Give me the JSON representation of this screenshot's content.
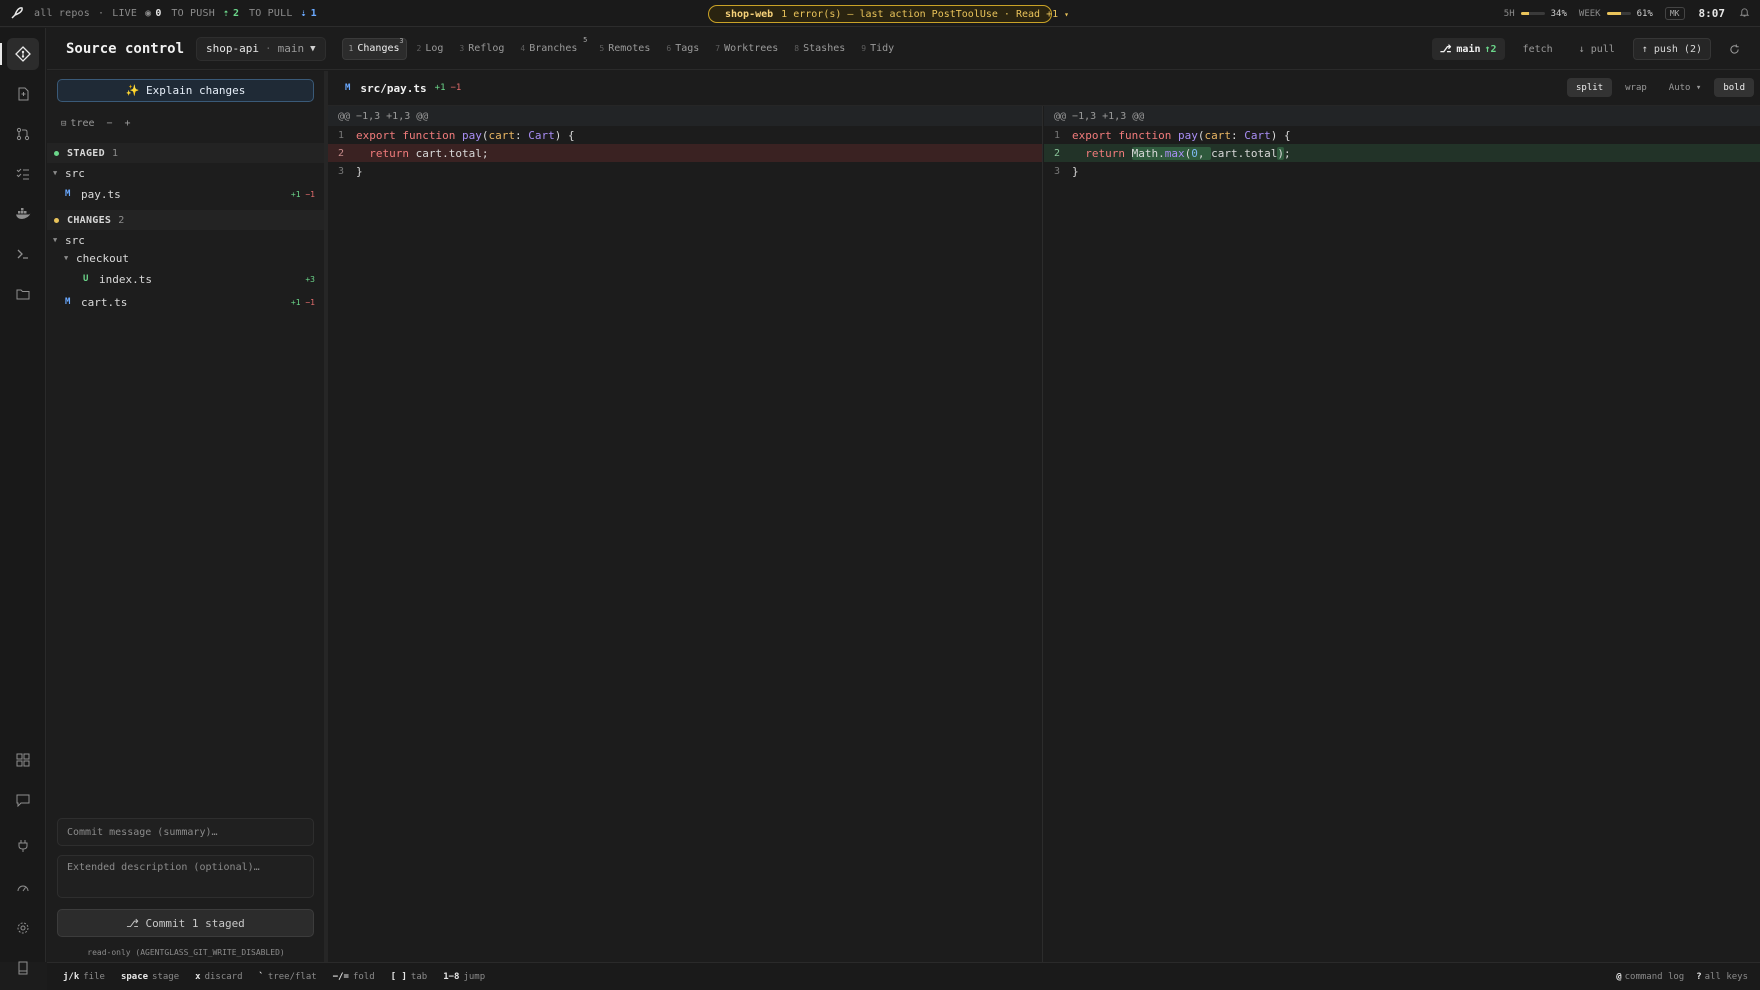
{
  "topbar": {
    "scope": "all repos",
    "live_label": "LIVE",
    "live_count": "0",
    "to_push_label": "TO PUSH",
    "to_push_count": "2",
    "to_pull_label": "TO PULL",
    "to_pull_count": "1",
    "alert": {
      "repo": "shop-web",
      "message": "1 error(s) — last action PostToolUse · Read +1",
      "caret": "▾"
    },
    "usage_5h_label": "5H",
    "usage_5h_pct": "34%",
    "usage_5h_fraction": 0.34,
    "usage_week_label": "WEEK",
    "usage_week_pct": "61%",
    "usage_week_fraction": 0.61,
    "user_initials": "MK",
    "clock": "8:07"
  },
  "header": {
    "title": "Source control",
    "repo": "shop-api",
    "branch": "main",
    "tabs": [
      {
        "num": "1",
        "label": "Changes",
        "badge": "3"
      },
      {
        "num": "2",
        "label": "Log",
        "badge": ""
      },
      {
        "num": "3",
        "label": "Reflog",
        "badge": ""
      },
      {
        "num": "4",
        "label": "Branches",
        "badge": "5"
      },
      {
        "num": "5",
        "label": "Remotes",
        "badge": ""
      },
      {
        "num": "6",
        "label": "Tags",
        "badge": ""
      },
      {
        "num": "7",
        "label": "Worktrees",
        "badge": ""
      },
      {
        "num": "8",
        "label": "Stashes",
        "badge": ""
      },
      {
        "num": "9",
        "label": "Tidy",
        "badge": ""
      }
    ],
    "branch_button": "main",
    "branch_ahead": "↑2",
    "fetch_label": "fetch",
    "pull_label": "↓ pull",
    "push_label": "↑ push (2)"
  },
  "panel": {
    "explain_label": "✨ Explain changes",
    "tree_label": "tree",
    "collapse_label": "−",
    "expand_label": "+",
    "staged": {
      "label": "STAGED",
      "count": "1",
      "folder": "src",
      "files": [
        {
          "status": "M",
          "name": "pay.ts",
          "add": "+1",
          "del": "−1"
        }
      ]
    },
    "changes": {
      "label": "CHANGES",
      "count": "2",
      "folder": "src",
      "subfolder": "checkout",
      "sub_files": [
        {
          "status": "U",
          "name": "index.ts",
          "add": "+3",
          "del": ""
        }
      ],
      "files": [
        {
          "status": "M",
          "name": "cart.ts",
          "add": "+1",
          "del": "−1"
        }
      ]
    },
    "commit_summary_placeholder": "Commit message (summary)…",
    "commit_desc_placeholder": "Extended description (optional)…",
    "commit_button": "⎇ Commit 1 staged",
    "readonly_note": "read-only (AGENTGLASS_GIT_WRITE_DISABLED)"
  },
  "diff": {
    "file_status": "M",
    "file_path": "src/pay.ts",
    "add": "+1",
    "del": "−1",
    "view_options": [
      "split",
      "wrap",
      "Auto ▾",
      "bold"
    ],
    "hunk": "@@ −1,3 +1,3 @@",
    "line_numbers": [
      "1",
      "2",
      "3"
    ]
  },
  "bottombar": {
    "hints": [
      {
        "key": "j/k",
        "label": "file"
      },
      {
        "key": "space",
        "label": "stage"
      },
      {
        "key": "x",
        "label": "discard"
      },
      {
        "key": "`",
        "label": "tree/flat"
      },
      {
        "key": "−/=",
        "label": "fold"
      },
      {
        "key": "[ ]",
        "label": "tab"
      },
      {
        "key": "1−8",
        "label": "jump"
      }
    ],
    "command_log_key": "@",
    "command_log_label": "command log",
    "all_keys_key": "?",
    "all_keys_label": "all keys"
  },
  "colors": {
    "accent_green": "#6bd68a",
    "accent_blue": "#6aa9ff",
    "warning": "#e9c35a",
    "removed_bg": "#3a2222",
    "added_bg": "#223328"
  }
}
